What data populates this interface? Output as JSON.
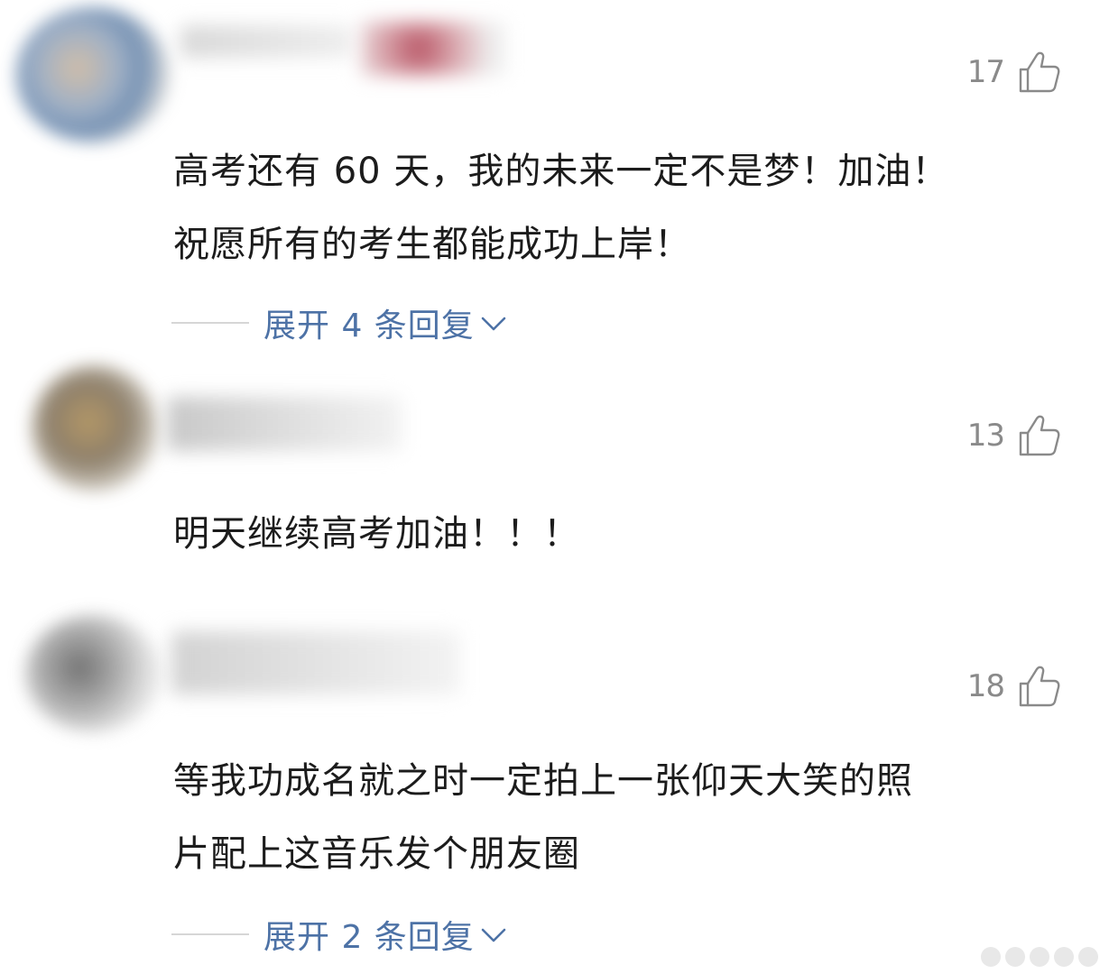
{
  "comments": [
    {
      "like_count": "17",
      "text_lines": [
        "高考还有 60 天，我的未来一定不是梦！加油！",
        "祝愿所有的考生都能成功上岸！"
      ],
      "expand_label": "展开 4 条回复"
    },
    {
      "like_count": "13",
      "text_lines": [
        "明天继续高考加油！！！"
      ]
    },
    {
      "like_count": "18",
      "text_lines": [
        "等我功成名就之时一定拍上一张仰天大笑的照",
        "片配上这音乐发个朋友圈"
      ],
      "expand_label": "展开 2 条回复"
    }
  ],
  "icons": {
    "like": "thumbs-up-icon",
    "expand": "chevron-down-icon"
  },
  "colors": {
    "link": "#4d72a6",
    "meta": "#8a8a8a",
    "text": "#1c1c1c",
    "divider": "#d6d6d6"
  }
}
